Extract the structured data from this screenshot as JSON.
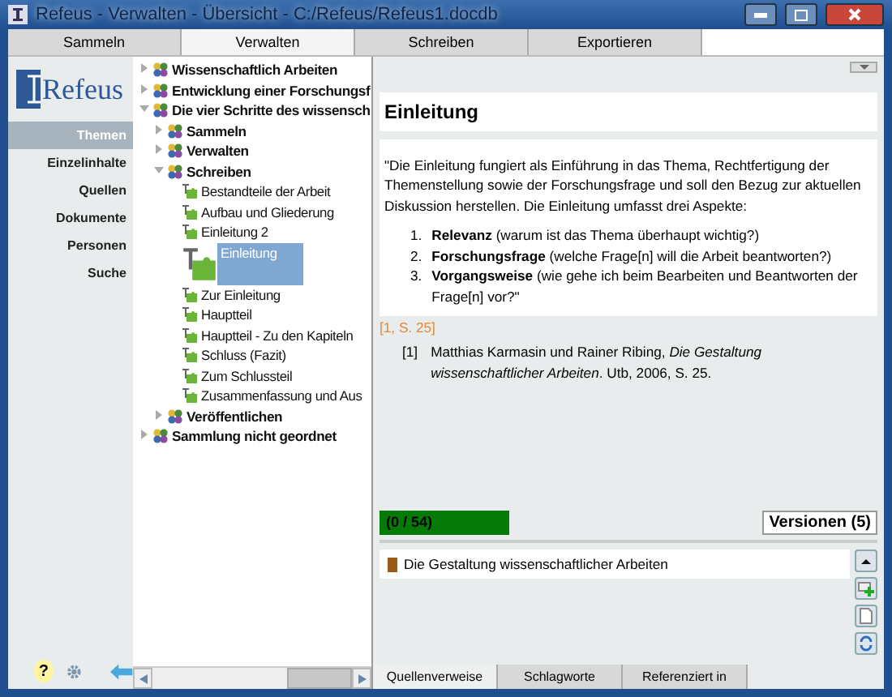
{
  "window": {
    "title": "Refeus - Verwalten - Übersicht - C:/Refeus/Refeus1.docdb"
  },
  "tabs": [
    {
      "label": "Sammeln",
      "selected": false
    },
    {
      "label": "Verwalten",
      "selected": true
    },
    {
      "label": "Schreiben",
      "selected": false
    },
    {
      "label": "Exportieren",
      "selected": false
    }
  ],
  "sidebar": {
    "logo": "Refeus",
    "items": [
      {
        "label": "Themen",
        "selected": true
      },
      {
        "label": "Einzelinhalte",
        "selected": false
      },
      {
        "label": "Quellen",
        "selected": false
      },
      {
        "label": "Dokumente",
        "selected": false
      },
      {
        "label": "Personen",
        "selected": false
      },
      {
        "label": "Suche",
        "selected": false
      }
    ],
    "help": "?"
  },
  "tree": [
    {
      "label": "Wissenschaftlich Arbeiten",
      "kind": "topic",
      "expanded": false,
      "selected": false
    },
    {
      "label": "Entwicklung einer Forschungsf",
      "kind": "topic",
      "expanded": false,
      "selected": false
    },
    {
      "label": "Die vier Schritte des wissensch",
      "kind": "topic",
      "expanded": true,
      "selected": false,
      "children": [
        {
          "label": "Sammeln",
          "kind": "topic",
          "expanded": false,
          "selected": false
        },
        {
          "label": "Verwalten",
          "kind": "topic",
          "expanded": false,
          "selected": false
        },
        {
          "label": "Schreiben",
          "kind": "topic",
          "expanded": true,
          "selected": false,
          "children": [
            {
              "label": "Bestandteile der Arbeit",
              "kind": "text",
              "selected": false
            },
            {
              "label": "Aufbau und Gliederung",
              "kind": "text",
              "selected": false
            },
            {
              "label": "Einleitung 2",
              "kind": "text",
              "selected": false
            },
            {
              "label": "Einleitung",
              "kind": "text",
              "selected": true
            },
            {
              "label": "Zur Einleitung",
              "kind": "text",
              "selected": false
            },
            {
              "label": "Hauptteil",
              "kind": "text",
              "selected": false
            },
            {
              "label": "Hauptteil - Zu den Kapiteln",
              "kind": "text",
              "selected": false
            },
            {
              "label": "Schluss (Fazit)",
              "kind": "text",
              "selected": false
            },
            {
              "label": "Zum Schlussteil",
              "kind": "text",
              "selected": false
            },
            {
              "label": "Zusammenfassung und Aus",
              "kind": "text",
              "selected": false
            }
          ]
        },
        {
          "label": "Veröffentlichen",
          "kind": "topic",
          "expanded": false,
          "selected": false
        }
      ]
    },
    {
      "label": "Sammlung nicht geordnet",
      "kind": "topic",
      "expanded": false,
      "selected": false
    }
  ],
  "content": {
    "heading": "Einleitung",
    "paragraph": "\"Die Einleitung fungiert als Einführung in das Thema, Rechtfertigung der Themenstellung sowie der Forschungsfrage und soll den Bezug zur aktuellen Diskussion herstellen. Die Einleitung umfasst drei Aspekte:",
    "list": [
      {
        "number": "1.",
        "text": "**Relevanz** (warum ist das Thema überhaupt wichtig?)"
      },
      {
        "number": "2.",
        "text": "**Forschungsfrage** (welche Frage[n] will die Arbeit beantworten?)"
      },
      {
        "number": "3.",
        "text": "**Vorgangsweise** (wie gehe ich beim Bearbeiten und Beantworten der Frage[n] vor?\""
      }
    ],
    "citation": "[1, S. 25]",
    "reference": {
      "number": "[1]",
      "text": "Matthias Karmasin und Rainer Ribing, *Die Gestaltung wissenschaftlicher Arbeiten*. Utb, 2006, S. 25."
    },
    "counter": "(0 / 54)",
    "versions": "Versionen (5)"
  },
  "sources": [
    {
      "title": "Die Gestaltung wissenschaftlicher Arbeiten"
    }
  ],
  "bottom_tabs": [
    {
      "label": "Quellenverweise",
      "selected": true
    },
    {
      "label": "Schlagworte",
      "selected": false
    },
    {
      "label": "Referenziert in",
      "selected": false
    }
  ]
}
